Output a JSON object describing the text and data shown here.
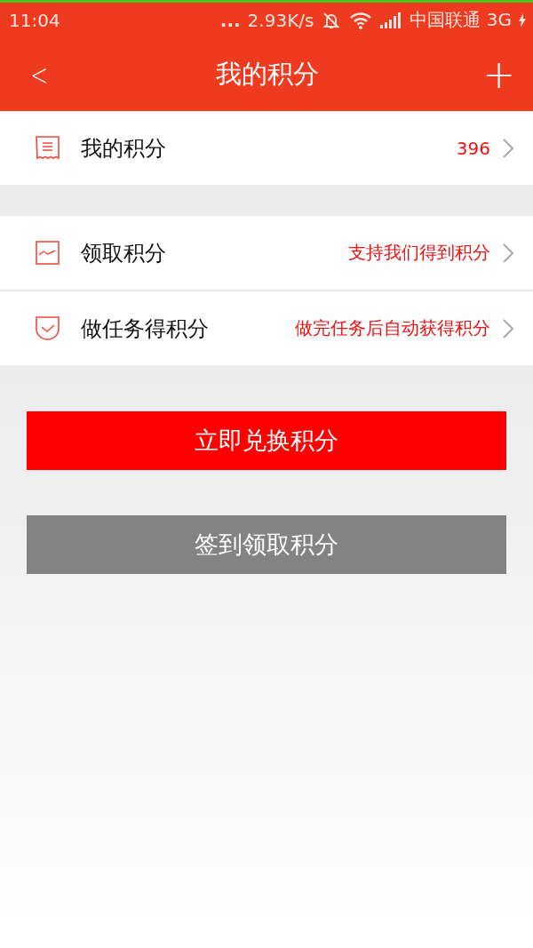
{
  "status_bar": {
    "time": "11:04",
    "more": "...",
    "speed": "2.93K/s",
    "carrier": "中国联通 3G"
  },
  "nav_bar": {
    "back": "<",
    "title": "我的积分",
    "add": "+"
  },
  "sections": [
    {
      "rows": [
        {
          "label": "我的积分",
          "value": "396"
        }
      ]
    },
    {
      "rows": [
        {
          "label": "领取积分",
          "value": "支持我们得到积分"
        },
        {
          "label": "做任务得积分",
          "value": "做完任务后自动获得积分"
        }
      ]
    }
  ],
  "buttons": [
    {
      "label": "立即兑换积分",
      "kind": "primary"
    },
    {
      "label": "签到领取积分",
      "kind": "secondary"
    }
  ]
}
